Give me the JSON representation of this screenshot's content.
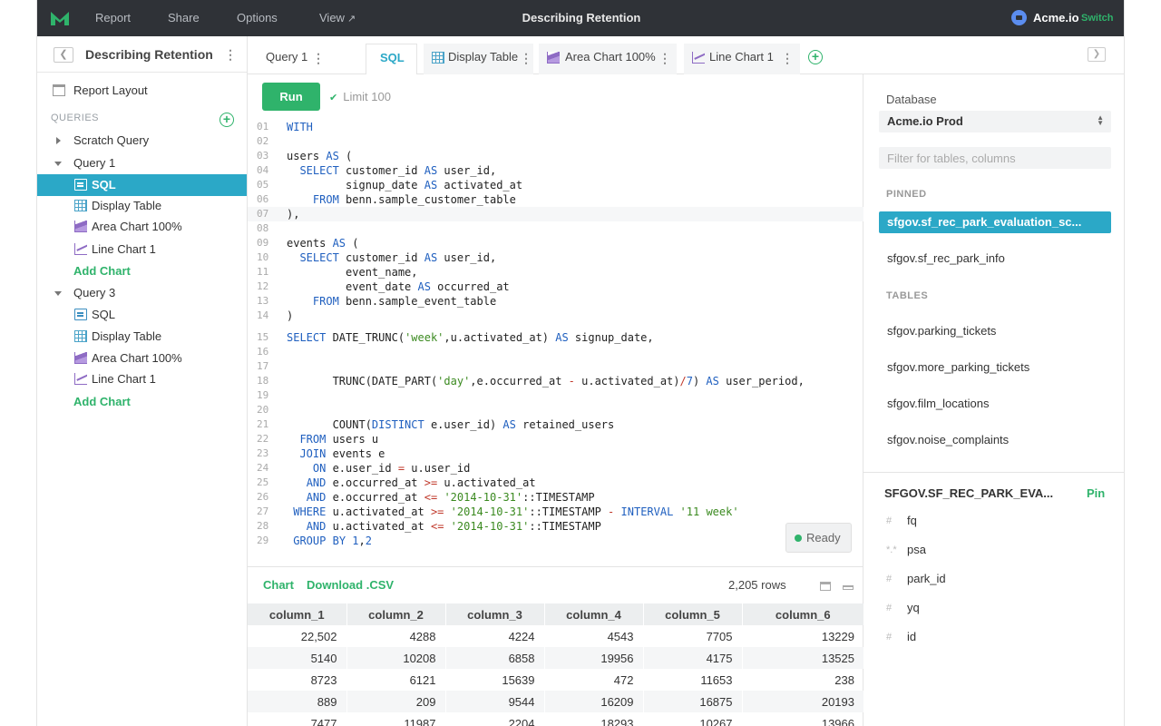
{
  "topbar": {
    "nav": [
      "Report",
      "Share",
      "Options",
      "View"
    ],
    "view_ext": "↗",
    "title": "Describing Retention",
    "account": "Acme.io",
    "switch": "Switch"
  },
  "sidebar": {
    "title": "Describing Retention",
    "report_layout": "Report Layout",
    "queries_label": "QUERIES",
    "scratch": "Scratch Query",
    "query1": {
      "label": "Query 1",
      "items": [
        "SQL",
        "Display Table",
        "Area Chart 100%",
        "Line Chart 1"
      ],
      "add_chart": "Add Chart"
    },
    "query3": {
      "label": "Query 3",
      "items": [
        "SQL",
        "Display Table",
        "Area Chart 100%",
        "Line Chart 1"
      ],
      "add_chart": "Add Chart"
    }
  },
  "tabs": [
    "Query 1",
    "SQL",
    "Display Table",
    "Area Chart 100%",
    "Line Chart 1"
  ],
  "editor": {
    "run": "Run",
    "limit": "Limit 100",
    "status": "Ready",
    "line_numbers": [
      "01",
      "02",
      "03",
      "04",
      "05",
      "06",
      "07",
      "08",
      "09",
      "10",
      "11",
      "12",
      "13",
      "14",
      "15",
      "16",
      "17",
      "18",
      "19",
      "20",
      "21",
      "22",
      "23",
      "24",
      "25",
      "26",
      "27",
      "28",
      "29"
    ],
    "code_lines": [
      "WITH",
      "",
      "users AS (",
      "  SELECT customer_id AS user_id,",
      "         signup_date AS activated_at",
      "    FROM benn.sample_customer_table",
      "),",
      "",
      "events AS (",
      "  SELECT customer_id AS user_id,",
      "         event_name,",
      "         event_date AS occurred_at",
      "    FROM benn.sample_event_table",
      ")",
      "SELECT DATE_TRUNC('week',u.activated_at) AS signup_date,",
      "",
      "",
      "       TRUNC(DATE_PART('day',e.occurred_at - u.activated_at)/7) AS user_period,",
      "",
      "",
      "       COUNT(DISTINCT e.user_id) AS retained_users",
      "  FROM users u",
      "  JOIN events e",
      "    ON e.user_id = u.user_id",
      "   AND e.occurred_at >= u.activated_at",
      "   AND e.occurred_at <= '2014-10-31'::TIMESTAMP",
      " WHERE u.activated_at >= '2014-10-31'::TIMESTAMP - INTERVAL '11 week'",
      "   AND u.activated_at <= '2014-10-31'::TIMESTAMP",
      " GROUP BY 1,2"
    ]
  },
  "results": {
    "chart": "Chart",
    "download": "Download .CSV",
    "row_count": "2,205 rows",
    "columns": [
      "column_1",
      "column_2",
      "column_3",
      "column_4",
      "column_5",
      "column_6"
    ],
    "rows": [
      [
        "22,502",
        "4288",
        "4224",
        "4543",
        "7705",
        "13229"
      ],
      [
        "5140",
        "10208",
        "6858",
        "19956",
        "4175",
        "13525"
      ],
      [
        "8723",
        "6121",
        "15639",
        "472",
        "11653",
        "238"
      ],
      [
        "889",
        "209",
        "9544",
        "16209",
        "16875",
        "20193"
      ],
      [
        "7477",
        "11987",
        "2204",
        "18293",
        "10267",
        "13966"
      ]
    ]
  },
  "schema": {
    "database_label": "Database",
    "database": "Acme.io Prod",
    "filter_placeholder": "Filter for tables, columns",
    "pinned_label": "PINNED",
    "pinned": [
      "sfgov.sf_rec_park_evaluation_sc...",
      "sfgov.sf_rec_park_info"
    ],
    "tables_label": "TABLES",
    "tables": [
      "sfgov.parking_tickets",
      "sfgov.more_parking_tickets",
      "sfgov.film_locations",
      "sfgov.noise_complaints"
    ],
    "detail_title": "SFGOV.SF_REC_PARK_EVA...",
    "pin": "Pin",
    "columns": [
      {
        "type": "#",
        "name": "fq"
      },
      {
        "type": "*.*",
        "name": "psa"
      },
      {
        "type": "#",
        "name": "park_id"
      },
      {
        "type": "#",
        "name": "yq"
      },
      {
        "type": "#",
        "name": "id"
      }
    ]
  },
  "colors": {
    "topbar": "#2f3237",
    "accent_blue": "#2ba8c7",
    "accent_green": "#2fb36b"
  }
}
